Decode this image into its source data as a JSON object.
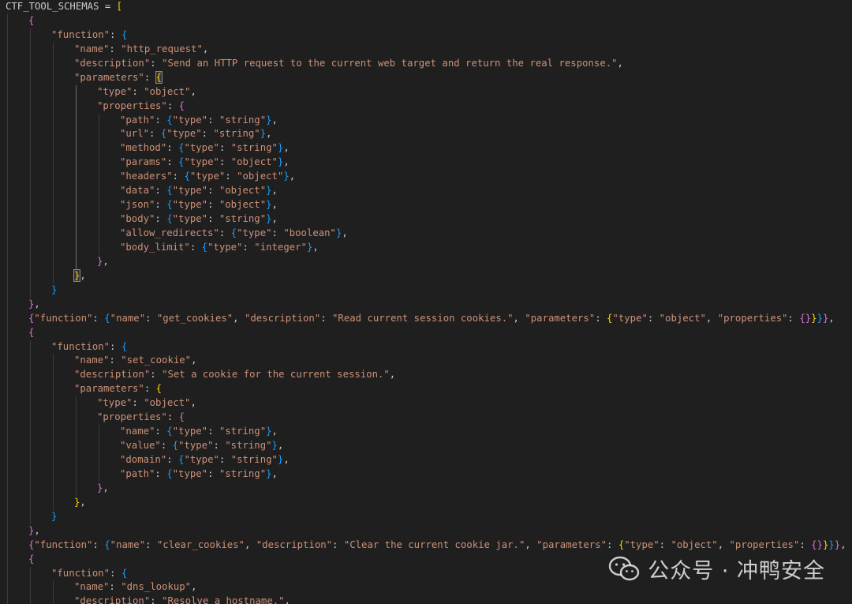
{
  "theme": {
    "background": "#1f1f1f",
    "text": "#cccccc",
    "key": "#9cdcfe",
    "string": "#ce9178",
    "bracket_level_1": "#ffd700",
    "bracket_level_2": "#da70d6",
    "bracket_level_3": "#179fff"
  },
  "editor": {
    "lines": [
      {
        "indent": 0,
        "tokens": [
          [
            "ident",
            "CTF_TOOL_SCHEMAS = "
          ],
          [
            "b1",
            "["
          ]
        ]
      },
      {
        "indent": 1,
        "tokens": [
          [
            "b2",
            "{"
          ]
        ]
      },
      {
        "indent": 2,
        "tokens": [
          [
            "str",
            "\"function\""
          ],
          [
            "punct",
            ": "
          ],
          [
            "b3",
            "{"
          ]
        ]
      },
      {
        "indent": 3,
        "tokens": [
          [
            "str",
            "\"name\""
          ],
          [
            "punct",
            ": "
          ],
          [
            "str",
            "\"http_request\""
          ],
          [
            "punct",
            ","
          ]
        ]
      },
      {
        "indent": 3,
        "tokens": [
          [
            "str",
            "\"description\""
          ],
          [
            "punct",
            ": "
          ],
          [
            "str",
            "\"Send an HTTP request to the current web target and return the real response.\""
          ],
          [
            "punct",
            ","
          ]
        ]
      },
      {
        "indent": 3,
        "tokens": [
          [
            "str",
            "\"parameters\""
          ],
          [
            "punct",
            ": "
          ],
          [
            "b1m",
            "{"
          ]
        ]
      },
      {
        "indent": 4,
        "tokens": [
          [
            "str",
            "\"type\""
          ],
          [
            "punct",
            ": "
          ],
          [
            "str",
            "\"object\""
          ],
          [
            "punct",
            ","
          ]
        ]
      },
      {
        "indent": 4,
        "tokens": [
          [
            "str",
            "\"properties\""
          ],
          [
            "punct",
            ": "
          ],
          [
            "b2",
            "{"
          ]
        ]
      },
      {
        "indent": 5,
        "tokens": [
          [
            "str",
            "\"path\""
          ],
          [
            "punct",
            ": "
          ],
          [
            "b3",
            "{"
          ],
          [
            "str",
            "\"type\""
          ],
          [
            "punct",
            ": "
          ],
          [
            "str",
            "\"string\""
          ],
          [
            "b3",
            "}"
          ],
          [
            "punct",
            ","
          ]
        ]
      },
      {
        "indent": 5,
        "tokens": [
          [
            "str",
            "\"url\""
          ],
          [
            "punct",
            ": "
          ],
          [
            "b3",
            "{"
          ],
          [
            "str",
            "\"type\""
          ],
          [
            "punct",
            ": "
          ],
          [
            "str",
            "\"string\""
          ],
          [
            "b3",
            "}"
          ],
          [
            "punct",
            ","
          ]
        ]
      },
      {
        "indent": 5,
        "tokens": [
          [
            "str",
            "\"method\""
          ],
          [
            "punct",
            ": "
          ],
          [
            "b3",
            "{"
          ],
          [
            "str",
            "\"type\""
          ],
          [
            "punct",
            ": "
          ],
          [
            "str",
            "\"string\""
          ],
          [
            "b3",
            "}"
          ],
          [
            "punct",
            ","
          ]
        ]
      },
      {
        "indent": 5,
        "tokens": [
          [
            "str",
            "\"params\""
          ],
          [
            "punct",
            ": "
          ],
          [
            "b3",
            "{"
          ],
          [
            "str",
            "\"type\""
          ],
          [
            "punct",
            ": "
          ],
          [
            "str",
            "\"object\""
          ],
          [
            "b3",
            "}"
          ],
          [
            "punct",
            ","
          ]
        ]
      },
      {
        "indent": 5,
        "tokens": [
          [
            "str",
            "\"headers\""
          ],
          [
            "punct",
            ": "
          ],
          [
            "b3",
            "{"
          ],
          [
            "str",
            "\"type\""
          ],
          [
            "punct",
            ": "
          ],
          [
            "str",
            "\"object\""
          ],
          [
            "b3",
            "}"
          ],
          [
            "punct",
            ","
          ]
        ]
      },
      {
        "indent": 5,
        "tokens": [
          [
            "str",
            "\"data\""
          ],
          [
            "punct",
            ": "
          ],
          [
            "b3",
            "{"
          ],
          [
            "str",
            "\"type\""
          ],
          [
            "punct",
            ": "
          ],
          [
            "str",
            "\"object\""
          ],
          [
            "b3",
            "}"
          ],
          [
            "punct",
            ","
          ]
        ]
      },
      {
        "indent": 5,
        "tokens": [
          [
            "str",
            "\"json\""
          ],
          [
            "punct",
            ": "
          ],
          [
            "b3",
            "{"
          ],
          [
            "str",
            "\"type\""
          ],
          [
            "punct",
            ": "
          ],
          [
            "str",
            "\"object\""
          ],
          [
            "b3",
            "}"
          ],
          [
            "punct",
            ","
          ]
        ]
      },
      {
        "indent": 5,
        "tokens": [
          [
            "str",
            "\"body\""
          ],
          [
            "punct",
            ": "
          ],
          [
            "b3",
            "{"
          ],
          [
            "str",
            "\"type\""
          ],
          [
            "punct",
            ": "
          ],
          [
            "str",
            "\"string\""
          ],
          [
            "b3",
            "}"
          ],
          [
            "punct",
            ","
          ]
        ]
      },
      {
        "indent": 5,
        "tokens": [
          [
            "str",
            "\"allow_redirects\""
          ],
          [
            "punct",
            ": "
          ],
          [
            "b3",
            "{"
          ],
          [
            "str",
            "\"type\""
          ],
          [
            "punct",
            ": "
          ],
          [
            "str",
            "\"boolean\""
          ],
          [
            "b3",
            "}"
          ],
          [
            "punct",
            ","
          ]
        ]
      },
      {
        "indent": 5,
        "tokens": [
          [
            "str",
            "\"body_limit\""
          ],
          [
            "punct",
            ": "
          ],
          [
            "b3",
            "{"
          ],
          [
            "str",
            "\"type\""
          ],
          [
            "punct",
            ": "
          ],
          [
            "str",
            "\"integer\""
          ],
          [
            "b3",
            "}"
          ],
          [
            "punct",
            ","
          ]
        ]
      },
      {
        "indent": 4,
        "tokens": [
          [
            "b2",
            "}"
          ],
          [
            "punct",
            ","
          ]
        ]
      },
      {
        "indent": 3,
        "tokens": [
          [
            "b1m",
            "}"
          ],
          [
            "punct",
            ","
          ]
        ]
      },
      {
        "indent": 2,
        "tokens": [
          [
            "b3",
            "}"
          ]
        ]
      },
      {
        "indent": 1,
        "tokens": [
          [
            "b2",
            "}"
          ],
          [
            "punct",
            ","
          ]
        ]
      },
      {
        "indent": 1,
        "tokens": [
          [
            "b2",
            "{"
          ],
          [
            "str",
            "\"function\""
          ],
          [
            "punct",
            ": "
          ],
          [
            "b3",
            "{"
          ],
          [
            "str",
            "\"name\""
          ],
          [
            "punct",
            ": "
          ],
          [
            "str",
            "\"get_cookies\""
          ],
          [
            "punct",
            ", "
          ],
          [
            "str",
            "\"description\""
          ],
          [
            "punct",
            ": "
          ],
          [
            "str",
            "\"Read current session cookies.\""
          ],
          [
            "punct",
            ", "
          ],
          [
            "str",
            "\"parameters\""
          ],
          [
            "punct",
            ": "
          ],
          [
            "b1",
            "{"
          ],
          [
            "str",
            "\"type\""
          ],
          [
            "punct",
            ": "
          ],
          [
            "str",
            "\"object\""
          ],
          [
            "punct",
            ", "
          ],
          [
            "str",
            "\"properties\""
          ],
          [
            "punct",
            ": "
          ],
          [
            "b2",
            "{}"
          ],
          [
            "b1",
            "}"
          ],
          [
            "b3",
            "}"
          ],
          [
            "b2",
            "}"
          ],
          [
            "punct",
            ","
          ]
        ]
      },
      {
        "indent": 1,
        "tokens": [
          [
            "b2",
            "{"
          ]
        ]
      },
      {
        "indent": 2,
        "tokens": [
          [
            "str",
            "\"function\""
          ],
          [
            "punct",
            ": "
          ],
          [
            "b3",
            "{"
          ]
        ]
      },
      {
        "indent": 3,
        "tokens": [
          [
            "str",
            "\"name\""
          ],
          [
            "punct",
            ": "
          ],
          [
            "str",
            "\"set_cookie\""
          ],
          [
            "punct",
            ","
          ]
        ]
      },
      {
        "indent": 3,
        "tokens": [
          [
            "str",
            "\"description\""
          ],
          [
            "punct",
            ": "
          ],
          [
            "str",
            "\"Set a cookie for the current session.\""
          ],
          [
            "punct",
            ","
          ]
        ]
      },
      {
        "indent": 3,
        "tokens": [
          [
            "str",
            "\"parameters\""
          ],
          [
            "punct",
            ": "
          ],
          [
            "b1",
            "{"
          ]
        ]
      },
      {
        "indent": 4,
        "tokens": [
          [
            "str",
            "\"type\""
          ],
          [
            "punct",
            ": "
          ],
          [
            "str",
            "\"object\""
          ],
          [
            "punct",
            ","
          ]
        ]
      },
      {
        "indent": 4,
        "tokens": [
          [
            "str",
            "\"properties\""
          ],
          [
            "punct",
            ": "
          ],
          [
            "b2",
            "{"
          ]
        ]
      },
      {
        "indent": 5,
        "tokens": [
          [
            "str",
            "\"name\""
          ],
          [
            "punct",
            ": "
          ],
          [
            "b3",
            "{"
          ],
          [
            "str",
            "\"type\""
          ],
          [
            "punct",
            ": "
          ],
          [
            "str",
            "\"string\""
          ],
          [
            "b3",
            "}"
          ],
          [
            "punct",
            ","
          ]
        ]
      },
      {
        "indent": 5,
        "tokens": [
          [
            "str",
            "\"value\""
          ],
          [
            "punct",
            ": "
          ],
          [
            "b3",
            "{"
          ],
          [
            "str",
            "\"type\""
          ],
          [
            "punct",
            ": "
          ],
          [
            "str",
            "\"string\""
          ],
          [
            "b3",
            "}"
          ],
          [
            "punct",
            ","
          ]
        ]
      },
      {
        "indent": 5,
        "tokens": [
          [
            "str",
            "\"domain\""
          ],
          [
            "punct",
            ": "
          ],
          [
            "b3",
            "{"
          ],
          [
            "str",
            "\"type\""
          ],
          [
            "punct",
            ": "
          ],
          [
            "str",
            "\"string\""
          ],
          [
            "b3",
            "}"
          ],
          [
            "punct",
            ","
          ]
        ]
      },
      {
        "indent": 5,
        "tokens": [
          [
            "str",
            "\"path\""
          ],
          [
            "punct",
            ": "
          ],
          [
            "b3",
            "{"
          ],
          [
            "str",
            "\"type\""
          ],
          [
            "punct",
            ": "
          ],
          [
            "str",
            "\"string\""
          ],
          [
            "b3",
            "}"
          ],
          [
            "punct",
            ","
          ]
        ]
      },
      {
        "indent": 4,
        "tokens": [
          [
            "b2",
            "}"
          ],
          [
            "punct",
            ","
          ]
        ]
      },
      {
        "indent": 3,
        "tokens": [
          [
            "b1",
            "}"
          ],
          [
            "punct",
            ","
          ]
        ]
      },
      {
        "indent": 2,
        "tokens": [
          [
            "b3",
            "}"
          ]
        ]
      },
      {
        "indent": 1,
        "tokens": [
          [
            "b2",
            "}"
          ],
          [
            "punct",
            ","
          ]
        ]
      },
      {
        "indent": 1,
        "tokens": [
          [
            "b2",
            "{"
          ],
          [
            "str",
            "\"function\""
          ],
          [
            "punct",
            ": "
          ],
          [
            "b3",
            "{"
          ],
          [
            "str",
            "\"name\""
          ],
          [
            "punct",
            ": "
          ],
          [
            "str",
            "\"clear_cookies\""
          ],
          [
            "punct",
            ", "
          ],
          [
            "str",
            "\"description\""
          ],
          [
            "punct",
            ": "
          ],
          [
            "str",
            "\"Clear the current cookie jar.\""
          ],
          [
            "punct",
            ", "
          ],
          [
            "str",
            "\"parameters\""
          ],
          [
            "punct",
            ": "
          ],
          [
            "b1",
            "{"
          ],
          [
            "str",
            "\"type\""
          ],
          [
            "punct",
            ": "
          ],
          [
            "str",
            "\"object\""
          ],
          [
            "punct",
            ", "
          ],
          [
            "str",
            "\"properties\""
          ],
          [
            "punct",
            ": "
          ],
          [
            "b2",
            "{}"
          ],
          [
            "b1",
            "}"
          ],
          [
            "b3",
            "}"
          ],
          [
            "b2",
            "}"
          ],
          [
            "punct",
            ","
          ]
        ]
      },
      {
        "indent": 1,
        "tokens": [
          [
            "b2",
            "{"
          ]
        ]
      },
      {
        "indent": 2,
        "tokens": [
          [
            "str",
            "\"function\""
          ],
          [
            "punct",
            ": "
          ],
          [
            "b3",
            "{"
          ]
        ]
      },
      {
        "indent": 3,
        "tokens": [
          [
            "str",
            "\"name\""
          ],
          [
            "punct",
            ": "
          ],
          [
            "str",
            "\"dns_lookup\""
          ],
          [
            "punct",
            ","
          ]
        ]
      },
      {
        "indent": 3,
        "tokens": [
          [
            "str",
            "\"description\""
          ],
          [
            "punct",
            ": "
          ],
          [
            "str",
            "\"Resolve a hostname.\""
          ],
          [
            "punct",
            ","
          ]
        ]
      }
    ]
  },
  "watermark": {
    "text": "公众号 · 冲鸭安全",
    "icon": "wechat-icon"
  }
}
